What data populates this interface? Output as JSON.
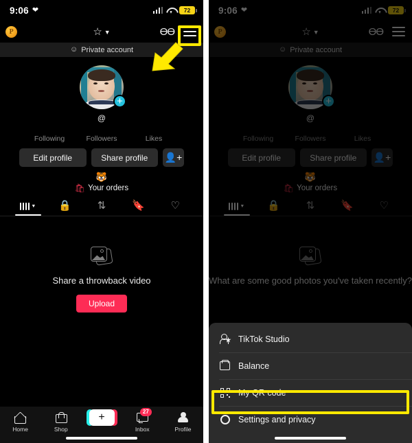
{
  "status_bar": {
    "time": "9:06",
    "heart_icon": "heart-icon",
    "signal_icon": "cellular-signal-icon",
    "wifi_icon": "wifi-icon",
    "battery_level": "72"
  },
  "app_header": {
    "coin_badge": "P",
    "star_icon": "star-icon",
    "chevron_icon": "chevron-down-icon",
    "footprint_icon": "footprints-icon",
    "menu_icon": "hamburger-menu-icon"
  },
  "private_strip": {
    "lock_icon": "person-lock-icon",
    "label": "Private account"
  },
  "profile": {
    "avatar_name": "profile-avatar",
    "add_badge": "+",
    "handle": "@",
    "stats": [
      {
        "label": "Following"
      },
      {
        "label": "Followers"
      },
      {
        "label": "Likes"
      }
    ],
    "edit_button": "Edit profile",
    "share_button": "Share profile",
    "add_friend_icon": "add-person-icon",
    "emoji": "🐯",
    "orders_icon": "shopping-bag-icon",
    "orders_label": "Your orders"
  },
  "content_tabs": [
    {
      "name": "grid-tab",
      "icon": "grid-bars-icon",
      "active": true
    },
    {
      "name": "private-tab",
      "icon": "lock-icon",
      "active": false
    },
    {
      "name": "reposts-tab",
      "icon": "repost-icon",
      "active": false
    },
    {
      "name": "saved-tab",
      "icon": "bookmark-slash-icon",
      "active": false
    },
    {
      "name": "liked-tab",
      "icon": "heart-slash-icon",
      "active": false
    }
  ],
  "empty_state_left": {
    "icon": "photo-stack-icon",
    "text": "Share a throwback video",
    "button": "Upload"
  },
  "empty_state_right": {
    "icon": "photo-stack-icon",
    "text": "What are some good photos you've taken recently?"
  },
  "bottom_nav": [
    {
      "label": "Home",
      "icon": "home-icon"
    },
    {
      "label": "Shop",
      "icon": "shopping-bag-icon"
    },
    {
      "label": "",
      "icon": "create-plus-icon"
    },
    {
      "label": "Inbox",
      "icon": "inbox-icon",
      "badge": "27"
    },
    {
      "label": "Profile",
      "icon": "person-icon"
    }
  ],
  "sheet_menu": [
    {
      "label": "TikTok Studio",
      "icon": "person-star-icon"
    },
    {
      "label": "Balance",
      "icon": "wallet-icon"
    },
    {
      "label": "My QR code",
      "icon": "qr-code-icon"
    },
    {
      "label": "Settings and privacy",
      "icon": "gear-icon",
      "highlighted": true
    }
  ],
  "annotations": {
    "highlight_color": "#ffe900",
    "arrow_color": "#ffe900",
    "targets": [
      "hamburger-menu-icon",
      "settings-and-privacy"
    ]
  }
}
